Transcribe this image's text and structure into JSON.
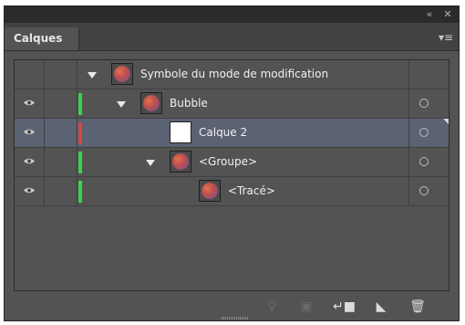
{
  "window": {
    "collapse_icon": "double-chevron-left-icon",
    "close_icon": "close-icon"
  },
  "panel": {
    "tab_label": "Calques",
    "menu_icon": "panel-menu-icon"
  },
  "layers": [
    {
      "name": "Symbole du mode de modification",
      "level": 0,
      "visible": false,
      "expanded": true,
      "thumb": "ball",
      "color": "",
      "target": false,
      "selected": false
    },
    {
      "name": "Bubble",
      "level": 1,
      "visible": true,
      "expanded": true,
      "thumb": "ball",
      "color": "#39d34a",
      "target": true,
      "selected": false
    },
    {
      "name": "Calque 2",
      "level": 2,
      "visible": true,
      "expanded": false,
      "thumb": "white",
      "color": "#d64646",
      "target": true,
      "selected": true
    },
    {
      "name": "<Groupe>",
      "level": 2,
      "visible": true,
      "expanded": true,
      "thumb": "ball",
      "color": "#39d34a",
      "target": true,
      "selected": false
    },
    {
      "name": "<Tracé>",
      "level": 3,
      "visible": true,
      "expanded": false,
      "thumb": "ball",
      "color": "#39d34a",
      "target": true,
      "selected": false
    }
  ],
  "toolbar": {
    "locate_icon": "search-icon",
    "clipping_mask_icon": "clipping-mask-icon",
    "new_sublayer_icon": "new-sublayer-icon",
    "new_layer_icon": "new-layer-icon",
    "delete_icon": "trash-icon"
  }
}
